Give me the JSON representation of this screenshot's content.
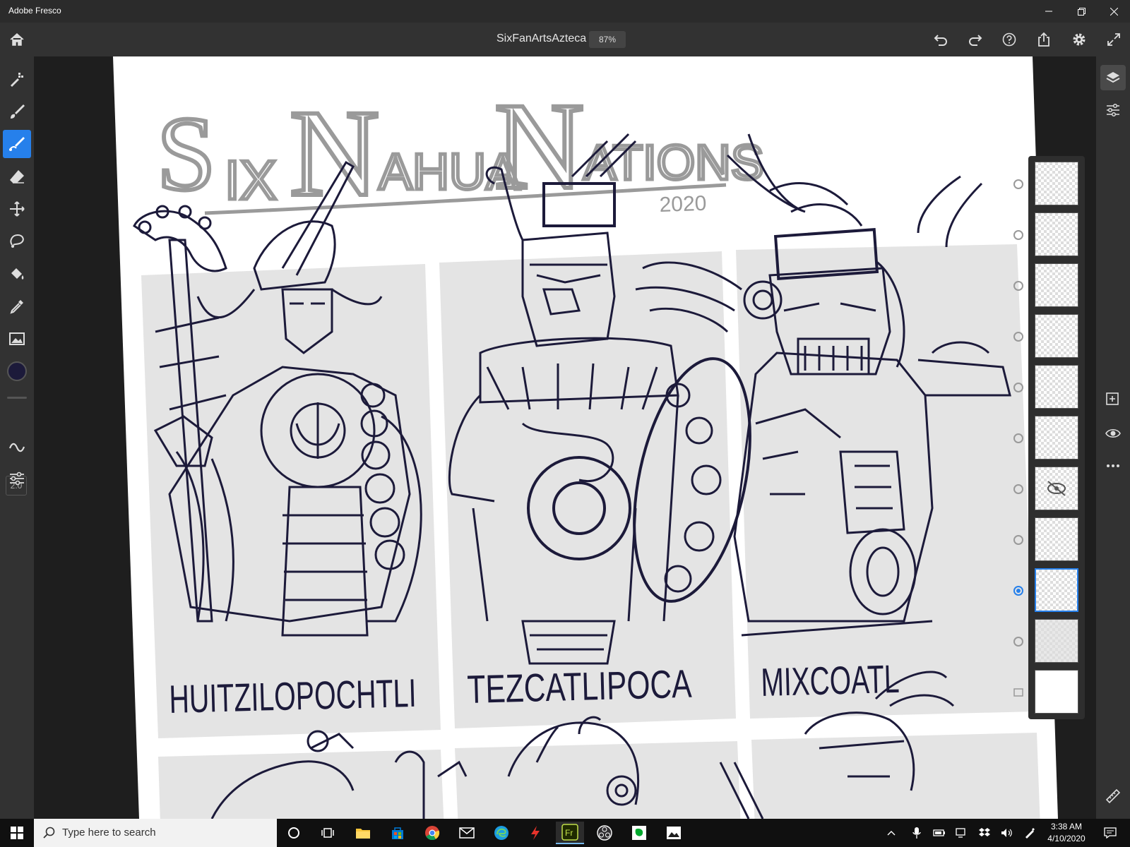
{
  "window": {
    "title": "Adobe Fresco"
  },
  "appbar": {
    "document_name": "SixFanArtsAzteca",
    "zoom": "87%"
  },
  "left_toolbar": {
    "brush_size": "2.0",
    "color": "#1c1a3a"
  },
  "canvas": {
    "title_line1": "Six Nahua Nations",
    "year": "2020",
    "panels": [
      {
        "name": "HUITZILOPOCHTLI"
      },
      {
        "name": "TEZCATLIPOCA"
      },
      {
        "name": "MIXCOATL"
      }
    ]
  },
  "layers": {
    "count": 11,
    "selected_index": 8,
    "hidden_index": 6
  },
  "taskbar": {
    "search_placeholder": "Type here to search",
    "time": "3:38 AM",
    "date": "4/10/2020"
  },
  "colors": {
    "accent": "#2680eb",
    "ink": "#1c1a3a",
    "panel": "#e4e4e4"
  }
}
